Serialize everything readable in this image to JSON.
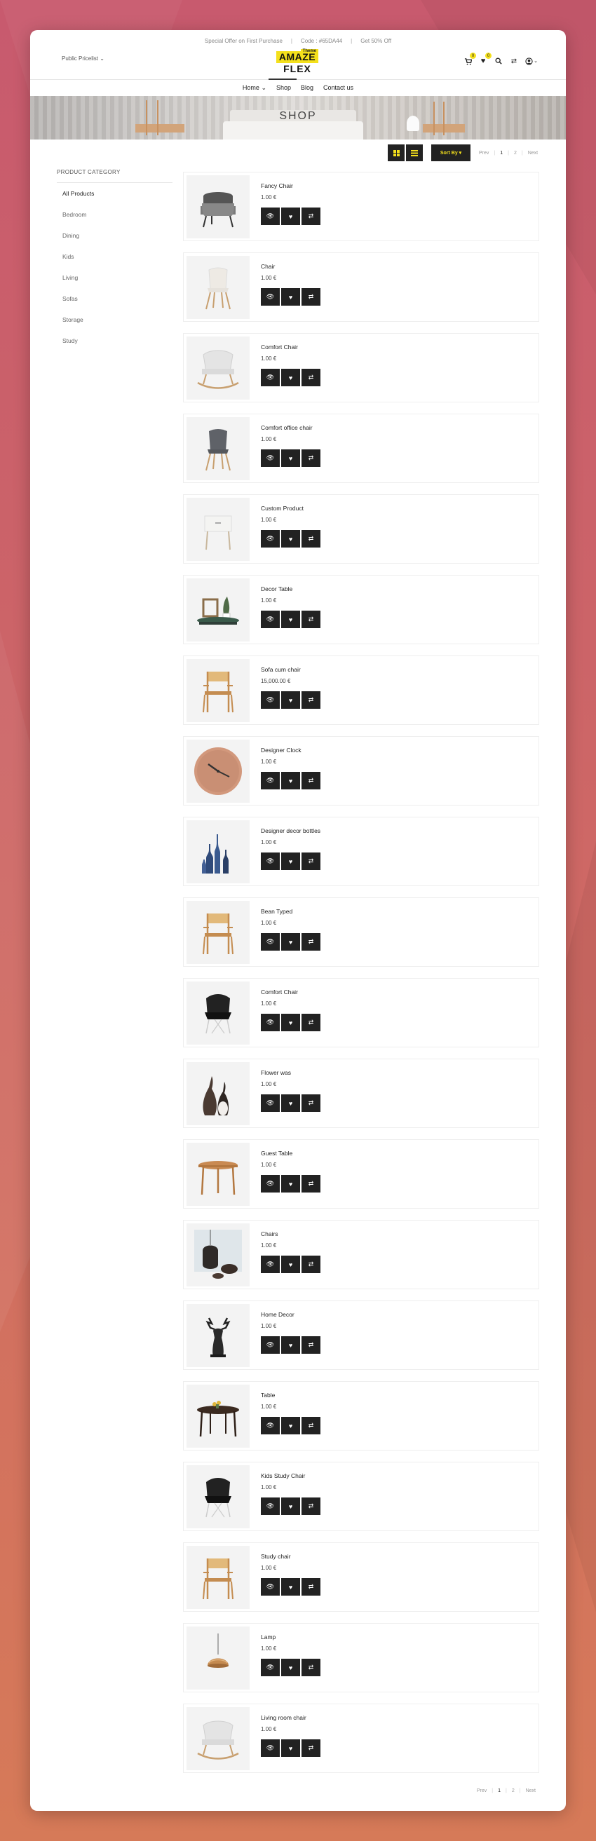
{
  "topbar": {
    "offer": "Special Offer on First Purchase",
    "code": "Code : #65DA44",
    "discount": "Get 50% Off",
    "separator": "|"
  },
  "header": {
    "pricelist": "Public Pricelist",
    "logo": {
      "tag": "Theme",
      "line1": "AMAZE",
      "line2": "FLEX"
    },
    "cart_count": "0",
    "wishlist_count": "0",
    "icons": [
      "cart-icon",
      "heart-icon",
      "search-icon",
      "compare-icon",
      "user-icon"
    ]
  },
  "nav": [
    "Home",
    "Shop",
    "Blog",
    "Contact us"
  ],
  "banner": {
    "title": "SHOP"
  },
  "sidebar": {
    "heading": "PRODUCT CATEGORY",
    "items": [
      "All Products",
      "Bedroom",
      "Dining",
      "Kids",
      "Living",
      "Sofas",
      "Storage",
      "Study"
    ]
  },
  "toolbar": {
    "sort_label": "Sort By",
    "prev": "Prev",
    "page1": "1",
    "page2": "2",
    "next": "Next",
    "sep": "|"
  },
  "products": [
    {
      "name": "Fancy Chair",
      "price": "1.00 €",
      "img": "armchair-grey"
    },
    {
      "name": "Chair",
      "price": "1.00 €",
      "img": "chair-white"
    },
    {
      "name": "Comfort Chair",
      "price": "1.00 €",
      "img": "rocker-white"
    },
    {
      "name": "Comfort office chair",
      "price": "1.00 €",
      "img": "chair-grey"
    },
    {
      "name": "Custom Product",
      "price": "1.00 €",
      "img": "side-table"
    },
    {
      "name": "Decor Table",
      "price": "1.00 €",
      "img": "decor-table"
    },
    {
      "name": "Sofa cum chair",
      "price": "15,000.00 €",
      "img": "wood-chair"
    },
    {
      "name": "Designer Clock",
      "price": "1.00 €",
      "img": "clock"
    },
    {
      "name": "Designer decor bottles",
      "price": "1.00 €",
      "img": "bottles"
    },
    {
      "name": "Bean Typed",
      "price": "1.00 €",
      "img": "wood-chair"
    },
    {
      "name": "Comfort Chair",
      "price": "1.00 €",
      "img": "chair-black"
    },
    {
      "name": "Flower was",
      "price": "1.00 €",
      "img": "vases"
    },
    {
      "name": "Guest Table",
      "price": "1.00 €",
      "img": "round-table"
    },
    {
      "name": "Chairs",
      "price": "1.00 €",
      "img": "hanging-chair"
    },
    {
      "name": "Home Decor",
      "price": "1.00 €",
      "img": "deer"
    },
    {
      "name": "Table",
      "price": "1.00 €",
      "img": "dark-table"
    },
    {
      "name": "Kids Study Chair",
      "price": "1.00 €",
      "img": "chair-black"
    },
    {
      "name": "Study chair",
      "price": "1.00 €",
      "img": "wood-chair"
    },
    {
      "name": "Lamp",
      "price": "1.00 €",
      "img": "lamp"
    },
    {
      "name": "Living room chair",
      "price": "1.00 €",
      "img": "rocker-white"
    }
  ],
  "actions": {
    "view": "👁",
    "wishlist": "♥",
    "compare": "⇄"
  },
  "colors": {
    "accent": "#f4e01c",
    "dark": "#222222"
  }
}
